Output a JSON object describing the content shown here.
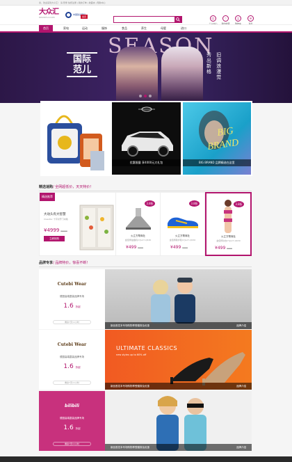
{
  "topbar": {
    "text": "亲，欢迎来到大众汇！ 请 登录 免费注册 | 我的订单 | 收藏夹 | 帮助中心"
  },
  "header": {
    "logo": "大众汇",
    "logo_sub": "DRSWHUI.COM",
    "partner": "中国建设银行",
    "partner_badge": "会员",
    "search_placeholder": "搜索商品/品牌",
    "icons": [
      {
        "name": "user-icon",
        "glyph": "☺",
        "label": "个人中心"
      },
      {
        "name": "heart-icon",
        "glyph": "♡",
        "label": "我的收藏"
      },
      {
        "name": "cart-icon",
        "glyph": "◫",
        "label": "购物车"
      },
      {
        "name": "message-icon",
        "glyph": "✉",
        "label": "消息"
      }
    ]
  },
  "nav": {
    "items": [
      "首页",
      "家电",
      "运动",
      "服饰",
      "食品",
      "养生",
      "母婴",
      "进口"
    ]
  },
  "hero": {
    "title": "SEASON",
    "cn_title_1": "国际",
    "cn_title_2": "范儿",
    "vertical_1": "秀出新格",
    "vertical_2": "旧调浪漫觉"
  },
  "features": [
    {
      "caption": ""
    },
    {
      "caption": "优惠限量 享4000元大礼包"
    },
    {
      "caption": "BIG BRAND 品牌精选在这里"
    }
  ],
  "picks": {
    "title": "精选速购",
    "subtitle": "/ 全网超低价，天天特价！",
    "lead": {
      "ribbon": "精选推荐",
      "name": "大动头有大智慧",
      "desc": "ClassTec 十字对开门冰箱",
      "price": "¥4999",
      "old": "¥6999",
      "button": "立即抢购"
    },
    "items": [
      {
        "pill": "3.8折",
        "name": "火立方帮商社",
        "desc": "金佰博油烟机CYJL27-Q630",
        "price": "¥499",
        "old": "¥999"
      },
      {
        "pill": "3.8折",
        "name": "火立方帮商社",
        "desc": "金佰博跑步鞋CYJL27-Q630",
        "price": "¥499",
        "old": "¥999"
      },
      {
        "pill": "3.8折",
        "name": "火立方帮商社",
        "desc": "金佰博泳衣CYJL27-Q630",
        "price": "¥499",
        "old": "¥999"
      }
    ]
  },
  "brands": {
    "title": "品牌专享",
    "subtitle": "/ 品牌特价，惊喜不断！",
    "blocks": [
      {
        "name": "Cutebi Wear",
        "line": "德国高端童装品牌专场",
        "discount": "1.6",
        "unit": "折起",
        "time": "剩余7天11小时",
        "bar": "新品首发本专场购物享受赠券及优惠",
        "more": "品牌介绍"
      },
      {
        "name": "Cutebi Wear",
        "line": "德国高端童装品牌专场",
        "discount": "1.6",
        "unit": "折起",
        "time": "剩余7天11小时",
        "bar": "新品首发本专场购物享受赠券及优惠",
        "more": "品牌介绍",
        "promo_title": "ULTIMATE CLASSICS",
        "promo_sub": "new styles up to 60% off"
      },
      {
        "name": "bilibili",
        "line": "德国高端童装品牌专场",
        "discount": "1.6",
        "unit": "折起",
        "time": "剩余7天11小时",
        "bar": "新品首发本专场购物享受赠券及优惠",
        "more": "品牌介绍"
      }
    ]
  },
  "colors": {
    "accent": "#b2146d",
    "hero_bg": "#3b2261"
  }
}
